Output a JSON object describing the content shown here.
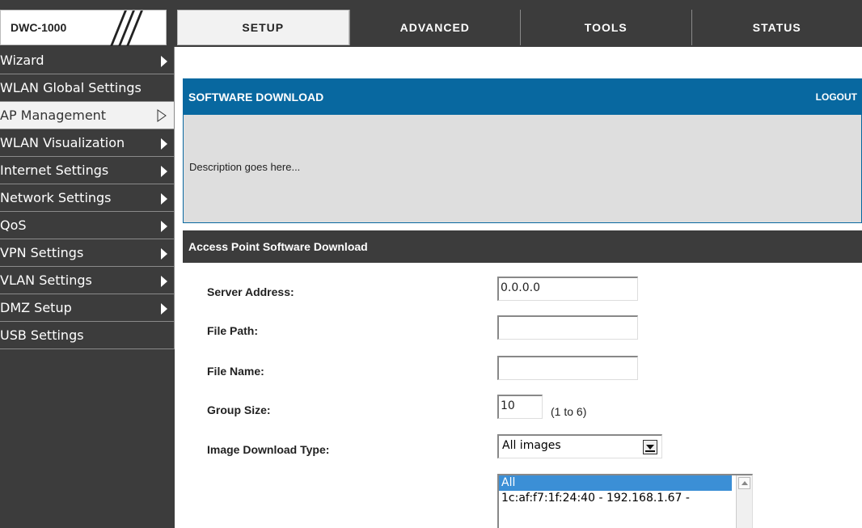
{
  "brand": {
    "model": "DWC-1000"
  },
  "tabs": [
    {
      "label": "SETUP",
      "active": true
    },
    {
      "label": "ADVANCED",
      "active": false
    },
    {
      "label": "TOOLS",
      "active": false
    },
    {
      "label": "STATUS",
      "active": false
    }
  ],
  "sidebar": {
    "items": [
      {
        "label": "Wizard"
      },
      {
        "label": "WLAN Global Settings"
      },
      {
        "label": "AP Management",
        "active": true
      },
      {
        "label": "WLAN Visualization"
      },
      {
        "label": "Internet Settings"
      },
      {
        "label": "Network Settings"
      },
      {
        "label": "QoS"
      },
      {
        "label": "VPN Settings"
      },
      {
        "label": "VLAN Settings"
      },
      {
        "label": "DMZ Setup"
      },
      {
        "label": "USB Settings"
      }
    ]
  },
  "panel": {
    "title": "SOFTWARE DOWNLOAD",
    "logout": "LOGOUT",
    "description": "Description goes here..."
  },
  "section": {
    "title": "Access Point Software Download",
    "server_address_label": "Server Address:",
    "server_address_value": "0.0.0.0",
    "file_path_label": "File Path:",
    "file_path_value": "",
    "file_name_label": "File Name:",
    "file_name_value": "",
    "group_size_label": "Group Size:",
    "group_size_value": "10",
    "group_size_hint": "(1 to 6)",
    "image_type_label": "Image Download Type:",
    "image_type_value": "All images",
    "ap_list": [
      {
        "label": "All",
        "selected": true
      },
      {
        "label": "1c:af:f7:1f:24:40 - 192.168.1.67 -",
        "selected": false
      }
    ]
  }
}
